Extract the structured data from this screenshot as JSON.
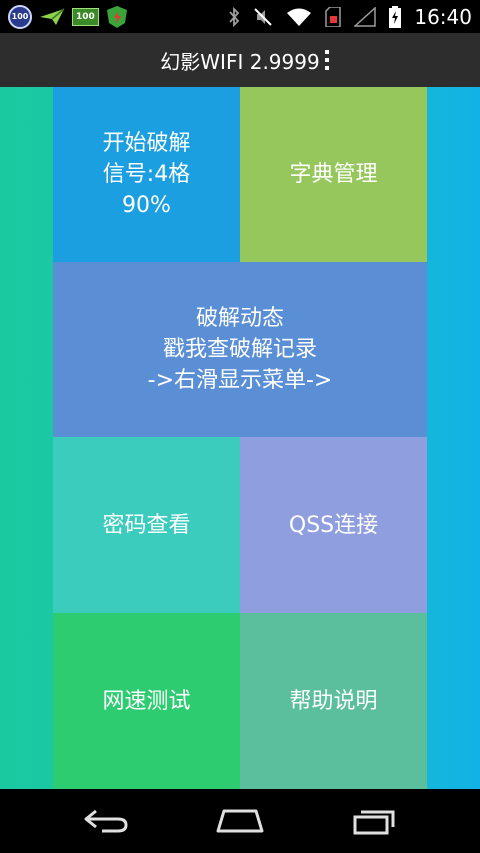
{
  "status_bar": {
    "badge1": "100",
    "badge2": "100",
    "time": "16:40",
    "icons": [
      "battery-saver-icon",
      "paper-plane-icon",
      "battery-100-icon",
      "app-shield-icon",
      "bluetooth-icon",
      "mute-icon",
      "wifi-icon",
      "sim-card-icon",
      "signal-icon",
      "battery-charging-icon"
    ]
  },
  "action_bar": {
    "title": "幻影WIFI 2.9999"
  },
  "tiles": {
    "crack": {
      "line1": "开始破解",
      "line2": "信号:4格",
      "line3": "90%",
      "color": "#1c9fe0"
    },
    "dict": {
      "label": "字典管理",
      "color": "#96c75c"
    },
    "dynamic": {
      "line1": "破解动态",
      "line2": "戳我查破解记录",
      "line3": "->右滑显示菜单->",
      "color": "#5a8fd6"
    },
    "password": {
      "label": "密码查看",
      "color": "#3cccbd"
    },
    "qss": {
      "label": "QSS连接",
      "color": "#8e9ede"
    },
    "speed": {
      "label": "网速测试",
      "color": "#2ecc71"
    },
    "help": {
      "label": "帮助说明",
      "color": "#5bbf9d"
    }
  },
  "nav_bar": {
    "icons": [
      "back-icon",
      "home-icon",
      "recent-apps-icon"
    ]
  }
}
